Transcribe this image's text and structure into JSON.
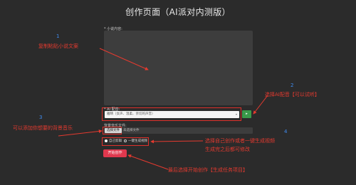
{
  "page": {
    "title": "创作页面（AI派对内测版）"
  },
  "form": {
    "novel_label": "* 小说内容:",
    "voice_label": "* AI 配音:",
    "voice_selected": "雅晴（女声、温柔、亲切的声音）",
    "play_label": "▸",
    "music_label": "背景音乐文件:",
    "file_button": "选择文件",
    "file_status": "未选择文件",
    "mode_options": [
      {
        "label": "自己剪辑",
        "selected": true
      },
      {
        "label": "一键生成视频",
        "selected": false
      }
    ],
    "start_button": "开始创作"
  },
  "annotations": {
    "n1": "1",
    "t1": "复制粘贴小说文案",
    "n2": "2",
    "t2": "选择AI配音【可以试听】",
    "n3": "3",
    "t3": "可以添加你想要的背景音乐",
    "n4": "4",
    "t4a": "选择自己创作或者一键生成视频",
    "t4b": "生成完之后都可修改",
    "t5": "最后选择开始创作【生成任务项目】"
  },
  "colors": {
    "background": "#2b2b2b",
    "panel": "#3d3d3d",
    "annotation_red": "#e53a2f",
    "annotation_blue": "#3f8cf0",
    "start_button": "#e0384e",
    "play_button": "#3a9a4a"
  }
}
